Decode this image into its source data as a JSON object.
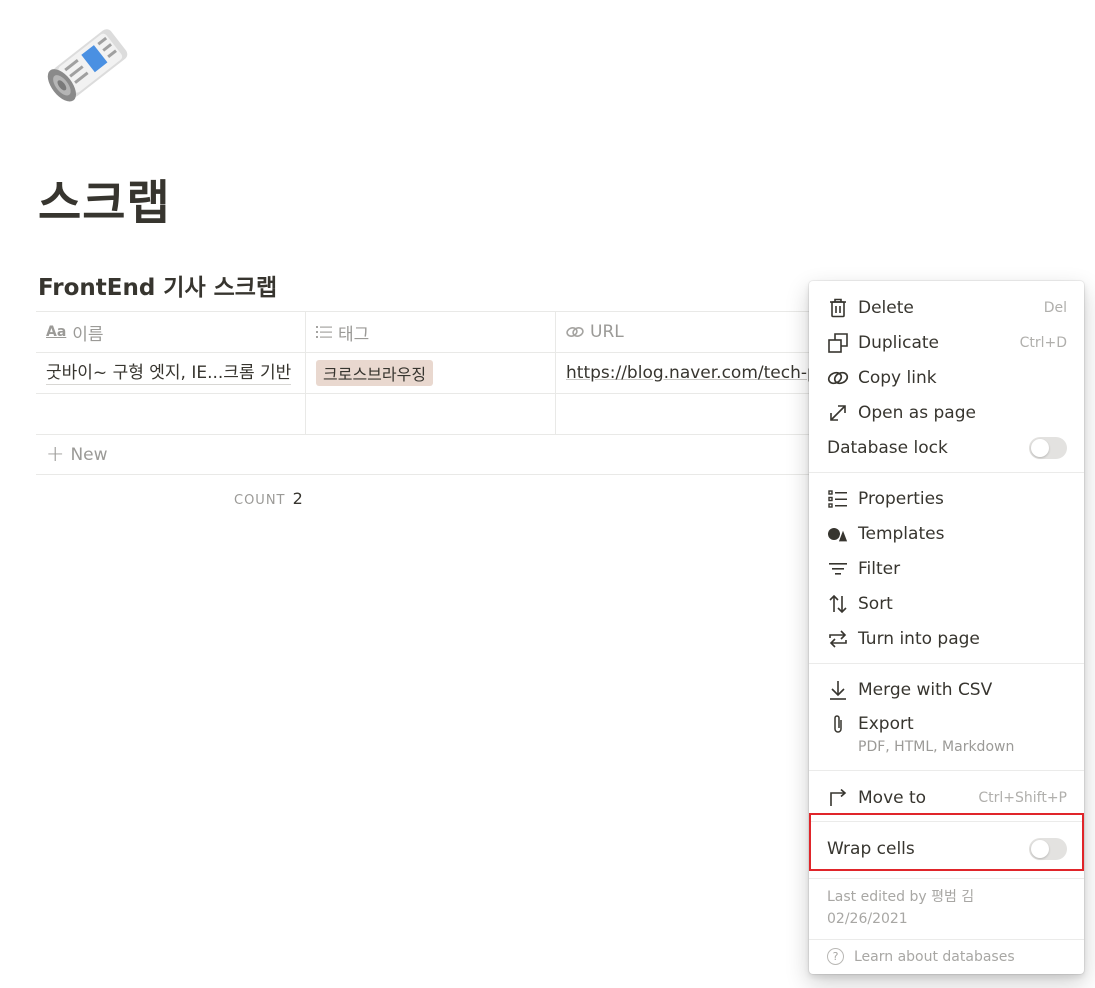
{
  "page": {
    "icon": "rolled-newspaper-icon",
    "title": "스크랩"
  },
  "database": {
    "title": "FrontEnd 기사 스크랩",
    "columns": [
      {
        "icon": "title-aa-icon",
        "icon_text": "Aa",
        "label": "이름"
      },
      {
        "icon": "list-icon",
        "label": "태그"
      },
      {
        "icon": "link-icon",
        "label": "URL"
      }
    ],
    "rows": [
      {
        "name": "굿바이~ 구형 엣지, IE...크롬 기반",
        "tag": "크로스브라우징",
        "url": "https://blog.naver.com/tech-pl"
      },
      {
        "name": "",
        "tag": "",
        "url": ""
      }
    ],
    "new_label": "New",
    "count_label": "COUNT",
    "count_value": "2",
    "tag_color": "#e9d8cf"
  },
  "menu": {
    "delete": {
      "label": "Delete",
      "shortcut": "Del",
      "icon": "trash-icon"
    },
    "duplicate": {
      "label": "Duplicate",
      "shortcut": "Ctrl+D",
      "icon": "duplicate-icon"
    },
    "copy_link": {
      "label": "Copy link",
      "icon": "link-icon"
    },
    "open_as_page": {
      "label": "Open as page",
      "icon": "expand-arrow-icon"
    },
    "database_lock": {
      "label": "Database lock",
      "on": false
    },
    "properties": {
      "label": "Properties",
      "icon": "properties-list-icon"
    },
    "templates": {
      "label": "Templates",
      "icon": "shapes-icon"
    },
    "filter": {
      "label": "Filter",
      "icon": "filter-icon"
    },
    "sort": {
      "label": "Sort",
      "icon": "sort-arrows-icon"
    },
    "turn_into_page": {
      "label": "Turn into page",
      "icon": "swap-arrows-icon"
    },
    "merge_csv": {
      "label": "Merge with CSV",
      "icon": "download-icon"
    },
    "export": {
      "label": "Export",
      "sub": "PDF, HTML, Markdown",
      "icon": "paperclip-icon"
    },
    "move_to": {
      "label": "Move to",
      "shortcut": "Ctrl+Shift+P",
      "icon": "move-arrow-icon"
    },
    "wrap_cells": {
      "label": "Wrap cells",
      "on": false
    },
    "last_edited": "Last edited by 평범 김",
    "last_edited_date": "02/26/2021",
    "learn": "Learn about databases",
    "highlight_color": "#e0252a"
  }
}
